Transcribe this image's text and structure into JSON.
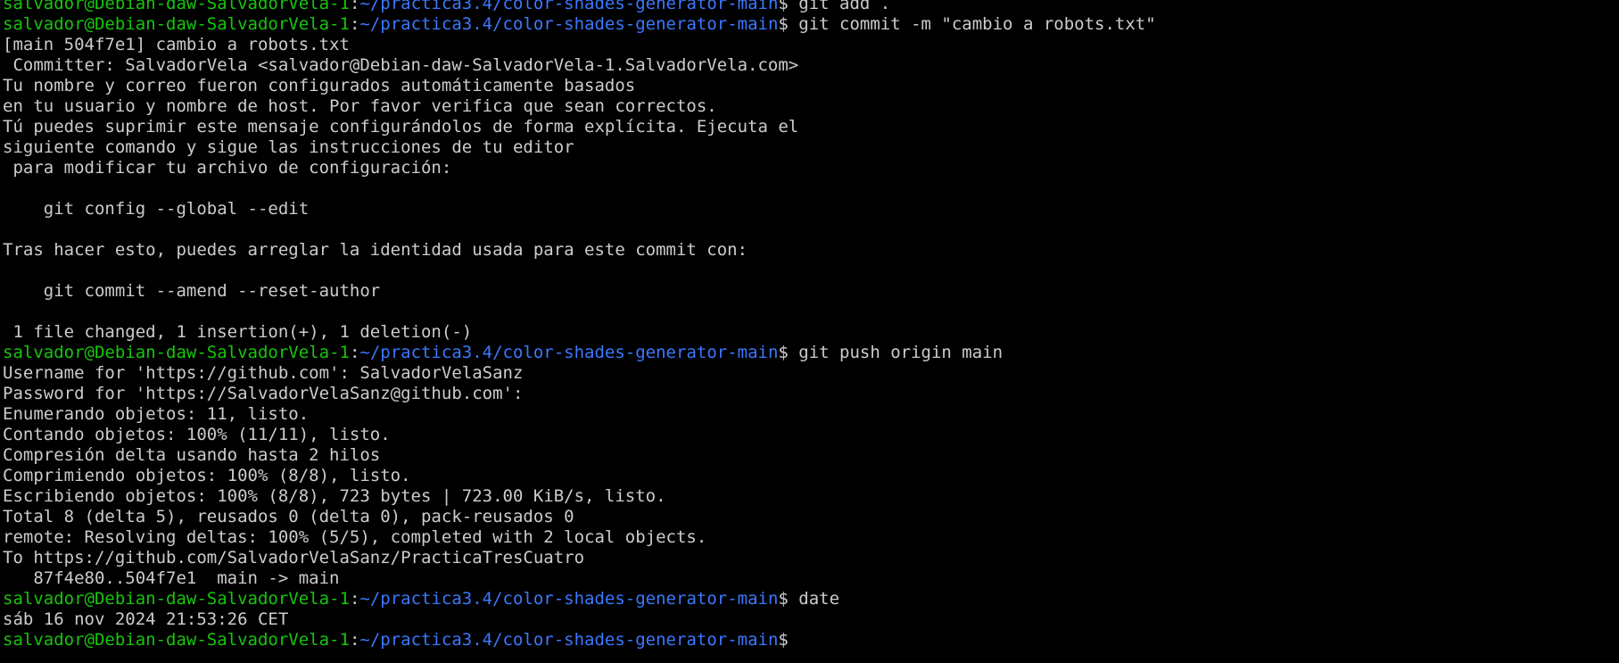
{
  "colors": {
    "background": "#000000",
    "text": "#cccccc",
    "user_host": "#16c60c",
    "path": "#3b78ff"
  },
  "prompt": {
    "user_host": "salvador@Debian-daw-SalvadorVela-1",
    "separator": ":",
    "path": "~/practica3.4/color-shades-generator-main",
    "symbol": "$"
  },
  "lines": [
    {
      "type": "prompt",
      "command": " git add ."
    },
    {
      "type": "prompt",
      "command": " git commit -m \"cambio a robots.txt\""
    },
    {
      "type": "output",
      "text": "[main 504f7e1] cambio a robots.txt"
    },
    {
      "type": "output",
      "text": " Committer: SalvadorVela <salvador@Debian-daw-SalvadorVela-1.SalvadorVela.com>"
    },
    {
      "type": "output",
      "text": "Tu nombre y correo fueron configurados automáticamente basados"
    },
    {
      "type": "output",
      "text": "en tu usuario y nombre de host. Por favor verifica que sean correctos."
    },
    {
      "type": "output",
      "text": "Tú puedes suprimir este mensaje configurándolos de forma explícita. Ejecuta el"
    },
    {
      "type": "output",
      "text": "siguiente comando y sigue las instrucciones de tu editor"
    },
    {
      "type": "output",
      "text": " para modificar tu archivo de configuración:"
    },
    {
      "type": "output",
      "text": ""
    },
    {
      "type": "output",
      "text": "    git config --global --edit"
    },
    {
      "type": "output",
      "text": ""
    },
    {
      "type": "output",
      "text": "Tras hacer esto, puedes arreglar la identidad usada para este commit con:"
    },
    {
      "type": "output",
      "text": ""
    },
    {
      "type": "output",
      "text": "    git commit --amend --reset-author"
    },
    {
      "type": "output",
      "text": ""
    },
    {
      "type": "output",
      "text": " 1 file changed, 1 insertion(+), 1 deletion(-)"
    },
    {
      "type": "prompt",
      "command": " git push origin main"
    },
    {
      "type": "output",
      "text": "Username for 'https://github.com': SalvadorVelaSanz"
    },
    {
      "type": "output",
      "text": "Password for 'https://SalvadorVelaSanz@github.com':"
    },
    {
      "type": "output",
      "text": "Enumerando objetos: 11, listo."
    },
    {
      "type": "output",
      "text": "Contando objetos: 100% (11/11), listo."
    },
    {
      "type": "output",
      "text": "Compresión delta usando hasta 2 hilos"
    },
    {
      "type": "output",
      "text": "Comprimiendo objetos: 100% (8/8), listo."
    },
    {
      "type": "output",
      "text": "Escribiendo objetos: 100% (8/8), 723 bytes | 723.00 KiB/s, listo."
    },
    {
      "type": "output",
      "text": "Total 8 (delta 5), reusados 0 (delta 0), pack-reusados 0"
    },
    {
      "type": "output",
      "text": "remote: Resolving deltas: 100% (5/5), completed with 2 local objects."
    },
    {
      "type": "output",
      "text": "To https://github.com/SalvadorVelaSanz/PracticaTresCuatro"
    },
    {
      "type": "output",
      "text": "   87f4e80..504f7e1  main -> main"
    },
    {
      "type": "prompt",
      "command": " date"
    },
    {
      "type": "output",
      "text": "sáb 16 nov 2024 21:53:26 CET"
    },
    {
      "type": "prompt",
      "command": ""
    }
  ]
}
